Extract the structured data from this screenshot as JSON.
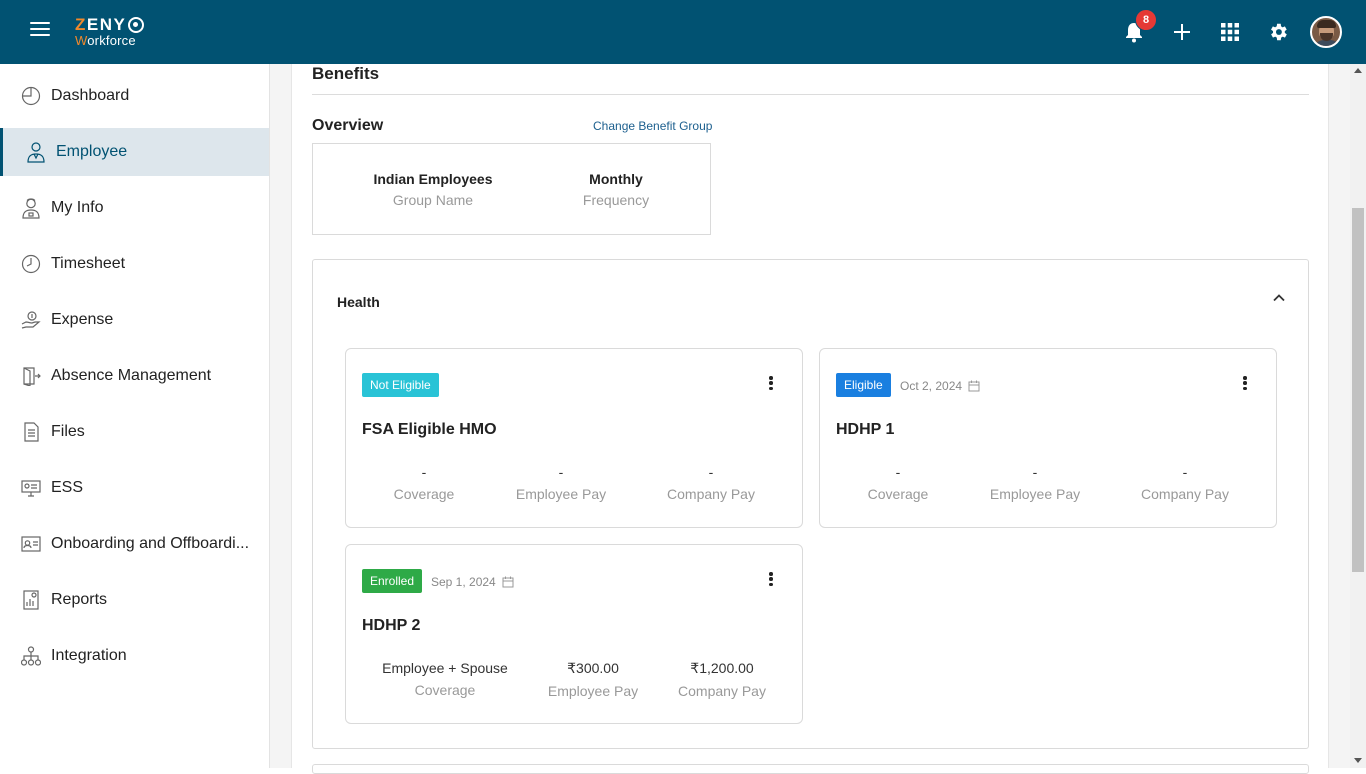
{
  "header": {
    "logo_top": "ZENY",
    "logo_bottom": "Workforce",
    "notification_count": "8",
    "colors": {
      "bar": "#015272",
      "accent": "#f0892c",
      "badge": "#e53935"
    },
    "icons": [
      "hamburger-icon",
      "bell-icon",
      "plus-icon",
      "apps-grid-icon",
      "gear-icon",
      "avatar"
    ]
  },
  "sidebar": {
    "items": [
      {
        "label": "Dashboard",
        "icon": "dashboard-pie-icon",
        "active": false
      },
      {
        "label": "Employee",
        "icon": "employee-icon",
        "active": true
      },
      {
        "label": "My Info",
        "icon": "my-info-icon",
        "active": false
      },
      {
        "label": "Timesheet",
        "icon": "clock-icon",
        "active": false
      },
      {
        "label": "Expense",
        "icon": "expense-hand-coin-icon",
        "active": false
      },
      {
        "label": "Absence Management",
        "icon": "door-exit-icon",
        "active": false
      },
      {
        "label": "Files",
        "icon": "file-icon",
        "active": false
      },
      {
        "label": "ESS",
        "icon": "ess-monitor-icon",
        "active": false
      },
      {
        "label": "Onboarding and Offboardi...",
        "icon": "id-card-icon",
        "active": false
      },
      {
        "label": "Reports",
        "icon": "report-icon",
        "active": false
      },
      {
        "label": "Integration",
        "icon": "integration-hierarchy-icon",
        "active": false
      }
    ]
  },
  "main": {
    "title": "Benefits",
    "overview": {
      "title": "Overview",
      "change_link": "Change Benefit Group",
      "group_name_value": "Indian Employees",
      "group_name_label": "Group Name",
      "frequency_value": "Monthly",
      "frequency_label": "Frequency"
    },
    "health": {
      "title": "Health",
      "cards": [
        {
          "status": "Not Eligible",
          "date": "",
          "name": "FSA Eligible HMO",
          "coverage_value": "-",
          "coverage_label": "Coverage",
          "employee_pay_value": "-",
          "employee_pay_label": "Employee Pay",
          "company_pay_value": "-",
          "company_pay_label": "Company Pay"
        },
        {
          "status": "Eligible",
          "date": "Oct 2, 2024",
          "name": "HDHP 1",
          "coverage_value": "-",
          "coverage_label": "Coverage",
          "employee_pay_value": "-",
          "employee_pay_label": "Employee Pay",
          "company_pay_value": "-",
          "company_pay_label": "Company Pay"
        },
        {
          "status": "Enrolled",
          "date": "Sep 1, 2024",
          "name": "HDHP 2",
          "coverage_value": "Employee + Spouse",
          "coverage_label": "Coverage",
          "employee_pay_value": "₹300.00",
          "employee_pay_label": "Employee Pay",
          "company_pay_value": "₹1,200.00",
          "company_pay_label": "Company Pay"
        }
      ]
    }
  }
}
